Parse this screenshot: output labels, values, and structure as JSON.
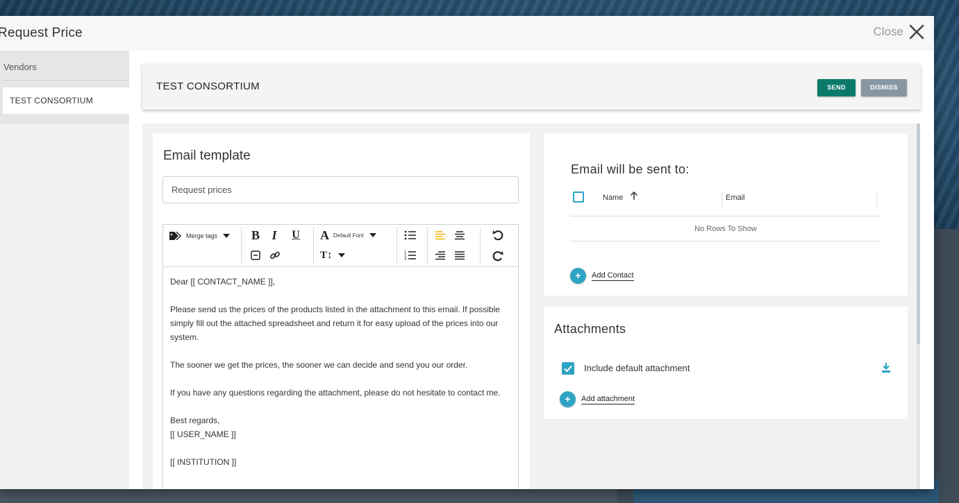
{
  "modal": {
    "title": "Request Price",
    "close_label": "Close"
  },
  "vendors": {
    "header": "Vendors",
    "items": [
      {
        "label": "TEST CONSORTIUM",
        "selected": true
      }
    ]
  },
  "vendor_bar": {
    "title": "TEST CONSORTIUM",
    "send_label": "SEND",
    "dismiss_label": "DISMISS"
  },
  "email_template": {
    "heading": "Email template",
    "subject_value": "Request prices",
    "toolbar": {
      "merge_tags_label": "Merge tags",
      "font_label": "Default Font"
    },
    "body_paragraphs": [
      "Dear [[ CONTACT_NAME ]],",
      "Please send us the prices of the products listed in the attachment to this email. If possible simply fill out the attached spreadsheet and return it for easy upload of the prices into our system.",
      "The sooner we get the prices, the sooner we can decide and send you our order.",
      "If you have any questions regarding the attachment, please do not hesitate to contact me."
    ],
    "signature": {
      "closing": "Best regards,",
      "user": "[[ USER_NAME ]]",
      "institution": "[[ INSTITUTION ]]"
    }
  },
  "recipients": {
    "heading": "Email will be sent to:",
    "columns": {
      "name": "Name",
      "email": "Email"
    },
    "empty_text": "No Rows To Show",
    "add_contact_label": "Add Contact"
  },
  "attachments": {
    "heading": "Attachments",
    "include_default_label": "Include default attachment",
    "include_default_checked": true,
    "add_attachment_label": "Add attachment"
  },
  "colors": {
    "accent": "#2fa3c4",
    "send": "#0b7a6a",
    "dismiss": "#8697a3",
    "highlight": "#f0b400"
  }
}
